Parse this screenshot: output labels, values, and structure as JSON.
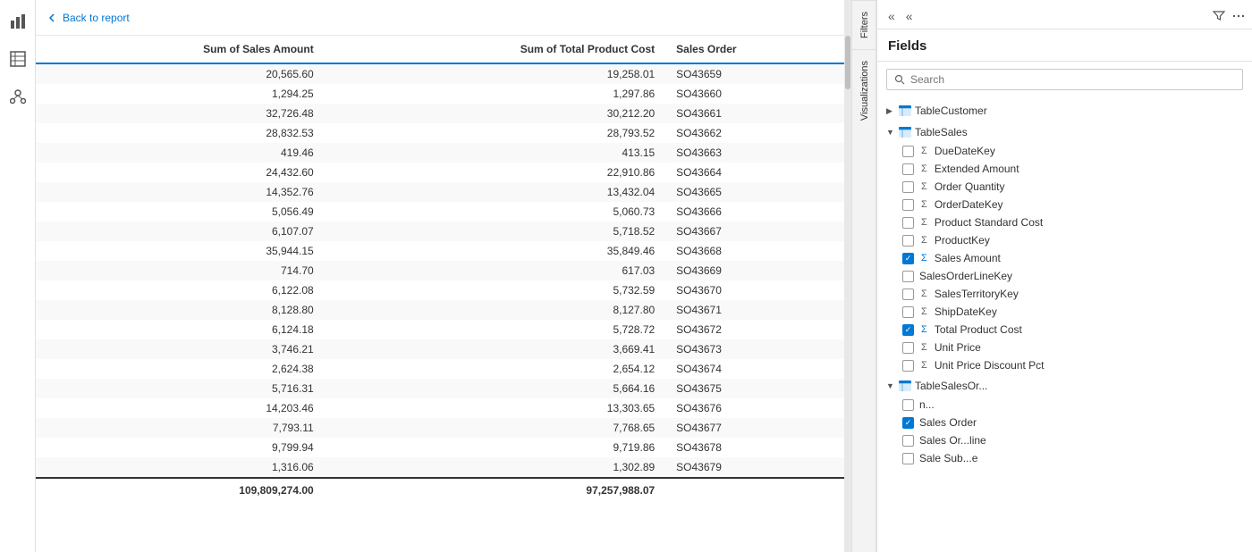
{
  "leftSidebar": {
    "icons": [
      {
        "name": "chart-icon",
        "glyph": "▦"
      },
      {
        "name": "table-icon",
        "glyph": "⊞"
      },
      {
        "name": "model-icon",
        "glyph": "⊟"
      }
    ]
  },
  "topBar": {
    "backLabel": "Back to report"
  },
  "table": {
    "headers": [
      "Sum of Sales Amount",
      "Sum of Total Product Cost",
      "Sales Order"
    ],
    "rows": [
      [
        "20,565.60",
        "19,258.01",
        "SO43659"
      ],
      [
        "1,294.25",
        "1,297.86",
        "SO43660"
      ],
      [
        "32,726.48",
        "30,212.20",
        "SO43661"
      ],
      [
        "28,832.53",
        "28,793.52",
        "SO43662"
      ],
      [
        "419.46",
        "413.15",
        "SO43663"
      ],
      [
        "24,432.60",
        "22,910.86",
        "SO43664"
      ],
      [
        "14,352.76",
        "13,432.04",
        "SO43665"
      ],
      [
        "5,056.49",
        "5,060.73",
        "SO43666"
      ],
      [
        "6,107.07",
        "5,718.52",
        "SO43667"
      ],
      [
        "35,944.15",
        "35,849.46",
        "SO43668"
      ],
      [
        "714.70",
        "617.03",
        "SO43669"
      ],
      [
        "6,122.08",
        "5,732.59",
        "SO43670"
      ],
      [
        "8,128.80",
        "8,127.80",
        "SO43671"
      ],
      [
        "6,124.18",
        "5,728.72",
        "SO43672"
      ],
      [
        "3,746.21",
        "3,669.41",
        "SO43673"
      ],
      [
        "2,624.38",
        "2,654.12",
        "SO43674"
      ],
      [
        "5,716.31",
        "5,664.16",
        "SO43675"
      ],
      [
        "14,203.46",
        "13,303.65",
        "SO43676"
      ],
      [
        "7,793.11",
        "7,768.65",
        "SO43677"
      ],
      [
        "9,799.94",
        "9,719.86",
        "SO43678"
      ],
      [
        "1,316.06",
        "1,302.89",
        "SO43679"
      ]
    ],
    "total": [
      "109,809,274.00",
      "97,257,988.07",
      ""
    ]
  },
  "sideTabs": {
    "visualizations": "Visualizations",
    "filters": "Filters"
  },
  "fieldsPanel": {
    "title": "Fields",
    "searchPlaceholder": "Search",
    "tableCustomer": {
      "name": "TableCustomer",
      "expanded": false
    },
    "tableSales": {
      "name": "TableSales",
      "expanded": true,
      "fields": [
        {
          "id": "DueDateKey",
          "label": "DueDateKey",
          "hasSigma": true,
          "checked": false
        },
        {
          "id": "ExtendedAmount",
          "label": "Extended Amount",
          "hasSigma": true,
          "checked": false
        },
        {
          "id": "OrderQuantity",
          "label": "Order Quantity",
          "hasSigma": true,
          "checked": false
        },
        {
          "id": "OrderDateKey",
          "label": "OrderDateKey",
          "hasSigma": true,
          "checked": false
        },
        {
          "id": "ProductStandardCost",
          "label": "Product Standard Cost",
          "hasSigma": true,
          "checked": false
        },
        {
          "id": "ProductKey",
          "label": "ProductKey",
          "hasSigma": true,
          "checked": false
        },
        {
          "id": "SalesAmount",
          "label": "Sales Amount",
          "hasSigma": true,
          "checked": true
        },
        {
          "id": "SalesOrderLineKey",
          "label": "SalesOrderLineKey",
          "hasSigma": false,
          "checked": false
        },
        {
          "id": "SalesTerritoryKey",
          "label": "SalesTerritoryKey",
          "hasSigma": true,
          "checked": false
        },
        {
          "id": "ShipDateKey",
          "label": "ShipDateKey",
          "hasSigma": true,
          "checked": false
        },
        {
          "id": "TotalProductCost",
          "label": "Total Product Cost",
          "hasSigma": true,
          "checked": true
        },
        {
          "id": "UnitPrice",
          "label": "Unit Price",
          "hasSigma": true,
          "checked": false
        },
        {
          "id": "UnitPriceDiscountPct",
          "label": "Unit Price Discount Pct",
          "hasSigma": true,
          "checked": false
        }
      ]
    },
    "tableSalesOrder": {
      "name": "TableSalesOr...",
      "expanded": true,
      "fields": [
        {
          "id": "field1",
          "label": "n...",
          "hasSigma": false,
          "checked": false
        },
        {
          "id": "SalesOrder",
          "label": "Sales Order",
          "hasSigma": false,
          "checked": true
        },
        {
          "id": "SalesOrderLine",
          "label": "Sales Or...line",
          "hasSigma": false,
          "checked": false
        },
        {
          "id": "SalesSubLine",
          "label": "Sale Sub...e",
          "hasSigma": false,
          "checked": false
        }
      ]
    }
  }
}
